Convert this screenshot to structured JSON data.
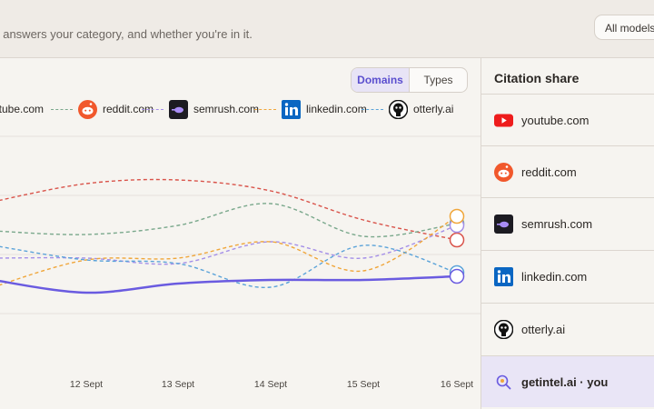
{
  "header": {
    "subtitle": "t answers your category, and whether you're in it.",
    "models_button": "All models"
  },
  "chart": {
    "toggle": {
      "domains": "Domains",
      "types": "Types"
    },
    "legend": [
      {
        "label": "utube.com",
        "color": "#d9534a",
        "icon": "youtube-icon"
      },
      {
        "label": "reddit.com",
        "color": "#7aa88c",
        "icon": "reddit-icon"
      },
      {
        "label": "semrush.com",
        "color": "#a48fe8",
        "icon": "semrush-icon"
      },
      {
        "label": "linkedin.com",
        "color": "#f0a63a",
        "icon": "linkedin-icon"
      },
      {
        "label": "otterly.ai",
        "color": "#5ba3d9",
        "icon": "otterly-icon"
      }
    ],
    "you_color": "#6a5be0"
  },
  "chart_data": {
    "type": "line",
    "categories": [
      "",
      "12 Sept",
      "13 Sept",
      "14 Sept",
      "15 Sept",
      "16 Sept"
    ],
    "series": [
      {
        "name": "youtube.com",
        "values": [
          8.4,
          9.4,
          9.6,
          9.0,
          7.4,
          6.3
        ]
      },
      {
        "name": "reddit.com",
        "values": [
          6.8,
          6.6,
          7.1,
          8.3,
          6.5,
          7.2
        ]
      },
      {
        "name": "semrush.com",
        "values": [
          5.3,
          5.3,
          5.0,
          6.2,
          5.3,
          7.1
        ]
      },
      {
        "name": "linkedin.com",
        "values": [
          3.7,
          5.2,
          5.3,
          6.2,
          4.6,
          7.6
        ]
      },
      {
        "name": "otterly.ai",
        "values": [
          6.0,
          5.2,
          5.0,
          3.7,
          6.0,
          4.5
        ]
      },
      {
        "name": "getintel.ai",
        "values": [
          4.1,
          3.4,
          3.9,
          4.1,
          4.1,
          4.3
        ]
      }
    ],
    "ylim": [
      0,
      12
    ]
  },
  "sidebar": {
    "title": "Citation share",
    "rows": [
      {
        "label": "youtube.com",
        "icon": "youtube-icon"
      },
      {
        "label": "reddit.com",
        "icon": "reddit-icon"
      },
      {
        "label": "semrush.com",
        "icon": "semrush-icon"
      },
      {
        "label": "linkedin.com",
        "icon": "linkedin-icon"
      },
      {
        "label": "otterly.ai",
        "icon": "otterly-icon"
      },
      {
        "label": "getintel.ai · you",
        "icon": "getintel-icon"
      }
    ]
  }
}
